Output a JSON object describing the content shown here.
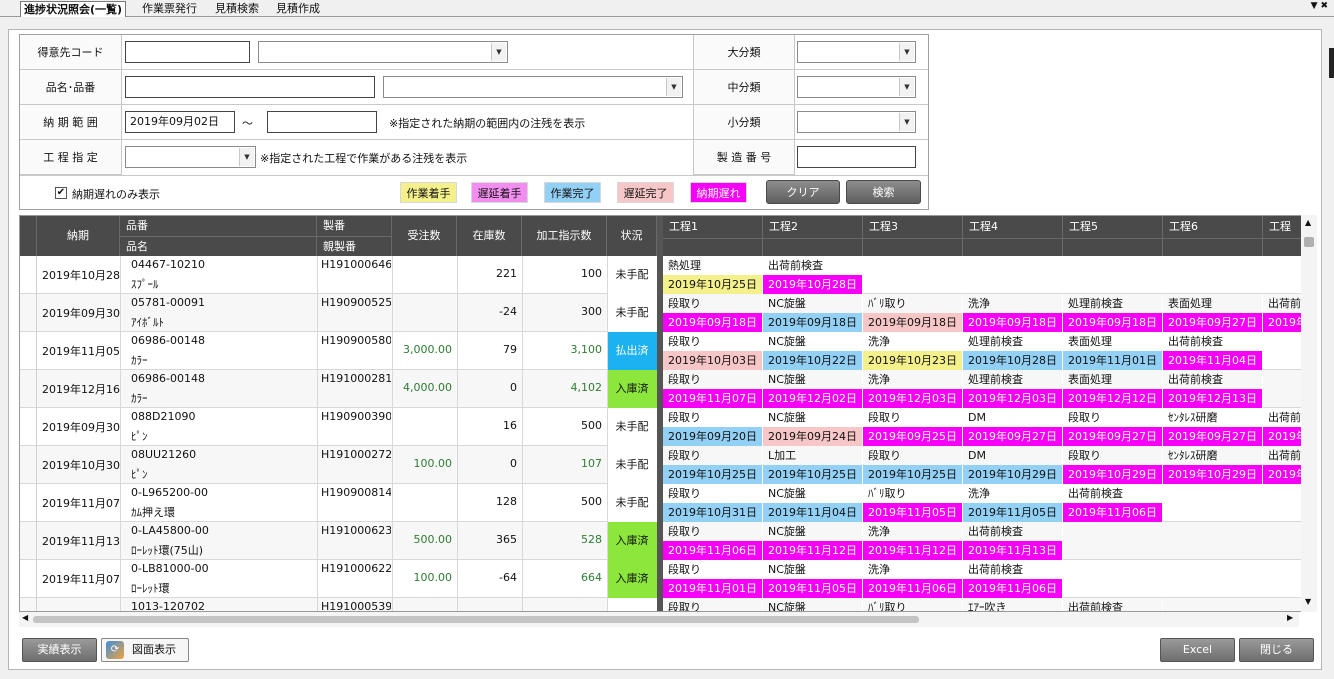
{
  "tabs": [
    "進捗状況照会(一覧)",
    "作業票発行",
    "見積検索",
    "見積作成"
  ],
  "filter": {
    "customer_label": "得意先コード",
    "item_label": "品名･品番",
    "period_label": "納 期 範 囲",
    "period_from": "2019年09月02日",
    "period_sep": "～",
    "period_note": "※指定された納期の範囲内の注残を表示",
    "process_label": "工 程 指 定",
    "process_note": "※指定された工程で作業がある注残を表示",
    "major_label": "大分類",
    "middle_label": "中分類",
    "minor_label": "小分類",
    "serial_label": "製 造 番 号",
    "late_only_label": "納期遅れのみ表示",
    "late_only_checked": "✔",
    "clear_button": "クリア",
    "search_button": "検索"
  },
  "legend": [
    {
      "label": "作業着手",
      "color": "#f4f08c"
    },
    {
      "label": "遅延着手",
      "color": "#f28ef0"
    },
    {
      "label": "作業完了",
      "color": "#92d0f5"
    },
    {
      "label": "遅延完了",
      "color": "#f7c7c7"
    },
    {
      "label": "納期遅れ",
      "color": "#f700f7"
    }
  ],
  "grid": {
    "headers": {
      "due": "納期",
      "item_no": "品番",
      "item_name": "品名",
      "serial": "製番",
      "parent_serial": "親製番",
      "ordered": "受注数",
      "stock": "在庫数",
      "instructed": "加工指示数",
      "status": "状況",
      "processes": [
        "工程1",
        "工程2",
        "工程3",
        "工程4",
        "工程5",
        "工程6",
        "工程"
      ]
    },
    "rows": [
      {
        "due": "2019年10月28日",
        "item_no": "04467-10210",
        "item_name": "ｽﾌﾟｰﾙ",
        "serial": "H191000646",
        "ordered": "",
        "stock": "221",
        "instructed": "100",
        "status": "未手配",
        "status_color": "#ffffff",
        "procs": [
          {
            "n": "熱処理",
            "d": "2019年10月25日",
            "c": "#f4f08c"
          },
          {
            "n": "出荷前検査",
            "d": "2019年10月28日",
            "c": "#f700f7"
          }
        ]
      },
      {
        "due": "2019年09月30日",
        "item_no": "05781-00091",
        "item_name": "ｱｲﾎﾞﾙﾄ",
        "serial": "H190900525",
        "ordered": "",
        "stock": "-24",
        "instructed": "300",
        "status": "未手配",
        "status_color": "#ffffff",
        "procs": [
          {
            "n": "段取り",
            "d": "2019年09月18日",
            "c": "#f700f7"
          },
          {
            "n": "NC旋盤",
            "d": "2019年09月18日",
            "c": "#92d0f5"
          },
          {
            "n": "ﾊﾞﾘ取り",
            "d": "2019年09月18日",
            "c": "#f7c7c7"
          },
          {
            "n": "洗浄",
            "d": "2019年09月18日",
            "c": "#f700f7"
          },
          {
            "n": "処理前検査",
            "d": "2019年09月18日",
            "c": "#f700f7"
          },
          {
            "n": "表面処理",
            "d": "2019年09月27日",
            "c": "#f700f7"
          },
          {
            "n": "出荷前",
            "d": "2019年",
            "c": "#f700f7"
          }
        ]
      },
      {
        "due": "2019年11月05日",
        "item_no": "06986-00148",
        "item_name": "ｶﾗｰ",
        "serial": "H190900580",
        "ordered": "3,000.00",
        "stock": "79",
        "instructed": "3,100",
        "status": "払出済",
        "status_color": "#1cb1f0",
        "procs": [
          {
            "n": "段取り",
            "d": "2019年10月03日",
            "c": "#f7c7c7"
          },
          {
            "n": "NC旋盤",
            "d": "2019年10月22日",
            "c": "#92d0f5"
          },
          {
            "n": "洗浄",
            "d": "2019年10月23日",
            "c": "#f4f08c"
          },
          {
            "n": "処理前検査",
            "d": "2019年10月28日",
            "c": "#92d0f5"
          },
          {
            "n": "表面処理",
            "d": "2019年11月01日",
            "c": "#92d0f5"
          },
          {
            "n": "出荷前検査",
            "d": "2019年11月04日",
            "c": "#f700f7"
          }
        ]
      },
      {
        "due": "2019年12月16日",
        "item_no": "06986-00148",
        "item_name": "ｶﾗｰ",
        "serial": "H191000281",
        "ordered": "4,000.00",
        "stock": "0",
        "instructed": "4,102",
        "status": "入庫済",
        "status_color": "#8ce63c",
        "procs": [
          {
            "n": "段取り",
            "d": "2019年11月07日",
            "c": "#f700f7"
          },
          {
            "n": "NC旋盤",
            "d": "2019年12月02日",
            "c": "#f700f7"
          },
          {
            "n": "洗浄",
            "d": "2019年12月03日",
            "c": "#f700f7"
          },
          {
            "n": "処理前検査",
            "d": "2019年12月03日",
            "c": "#f700f7"
          },
          {
            "n": "表面処理",
            "d": "2019年12月12日",
            "c": "#f700f7"
          },
          {
            "n": "出荷前検査",
            "d": "2019年12月13日",
            "c": "#f700f7"
          }
        ]
      },
      {
        "due": "2019年09月30日",
        "item_no": "088D21090",
        "item_name": "ﾋﾟﾝ",
        "serial": "H190900390",
        "ordered": "",
        "stock": "16",
        "instructed": "500",
        "status": "未手配",
        "status_color": "#ffffff",
        "procs": [
          {
            "n": "段取り",
            "d": "2019年09月20日",
            "c": "#92d0f5"
          },
          {
            "n": "NC旋盤",
            "d": "2019年09月24日",
            "c": "#f7c7c7"
          },
          {
            "n": "段取り",
            "d": "2019年09月25日",
            "c": "#f700f7"
          },
          {
            "n": "DM",
            "d": "2019年09月27日",
            "c": "#f700f7"
          },
          {
            "n": "段取り",
            "d": "2019年09月27日",
            "c": "#f700f7"
          },
          {
            "n": "ｾﾝﾀﾚｽ研磨",
            "d": "2019年09月27日",
            "c": "#f700f7"
          },
          {
            "n": "出荷前",
            "d": "2019年",
            "c": "#f700f7"
          }
        ]
      },
      {
        "due": "2019年10月30日",
        "item_no": "08UU21260",
        "item_name": "ﾋﾟﾝ",
        "serial": "H191000272",
        "ordered": "100.00",
        "stock": "0",
        "instructed": "107",
        "status": "未手配",
        "status_color": "#ffffff",
        "procs": [
          {
            "n": "段取り",
            "d": "2019年10月25日",
            "c": "#92d0f5"
          },
          {
            "n": "L加工",
            "d": "2019年10月25日",
            "c": "#92d0f5"
          },
          {
            "n": "段取り",
            "d": "2019年10月25日",
            "c": "#92d0f5"
          },
          {
            "n": "DM",
            "d": "2019年10月29日",
            "c": "#92d0f5"
          },
          {
            "n": "段取り",
            "d": "2019年10月29日",
            "c": "#f700f7"
          },
          {
            "n": "ｾﾝﾀﾚｽ研磨",
            "d": "2019年10月29日",
            "c": "#f700f7"
          },
          {
            "n": "出荷前",
            "d": "2019年",
            "c": "#f700f7"
          }
        ]
      },
      {
        "due": "2019年11月07日",
        "item_no": "0-L965200-00",
        "item_name": "ｶﾑ押え環",
        "serial": "H190900814",
        "ordered": "",
        "stock": "128",
        "instructed": "500",
        "status": "未手配",
        "status_color": "#ffffff",
        "procs": [
          {
            "n": "段取り",
            "d": "2019年10月31日",
            "c": "#92d0f5"
          },
          {
            "n": "NC旋盤",
            "d": "2019年11月04日",
            "c": "#92d0f5"
          },
          {
            "n": "ﾊﾞﾘ取り",
            "d": "2019年11月05日",
            "c": "#f700f7"
          },
          {
            "n": "洗浄",
            "d": "2019年11月05日",
            "c": "#92d0f5"
          },
          {
            "n": "出荷前検査",
            "d": "2019年11月06日",
            "c": "#f700f7"
          }
        ]
      },
      {
        "due": "2019年11月13日",
        "item_no": "0-LA45800-00",
        "item_name": "ﾛｰﾚｯﾄ環(75山)",
        "serial": "H191000623",
        "ordered": "500.00",
        "stock": "365",
        "instructed": "528",
        "status": "入庫済",
        "status_color": "#8ce63c",
        "procs": [
          {
            "n": "段取り",
            "d": "2019年11月06日",
            "c": "#f700f7"
          },
          {
            "n": "NC旋盤",
            "d": "2019年11月12日",
            "c": "#f700f7"
          },
          {
            "n": "洗浄",
            "d": "2019年11月12日",
            "c": "#f700f7"
          },
          {
            "n": "出荷前検査",
            "d": "2019年11月13日",
            "c": "#f700f7"
          }
        ]
      },
      {
        "due": "2019年11月07日",
        "item_no": "0-LB81000-00",
        "item_name": "ﾛｰﾚｯﾄ環",
        "serial": "H191000622",
        "ordered": "100.00",
        "stock": "-64",
        "instructed": "664",
        "status": "入庫済",
        "status_color": "#8ce63c",
        "procs": [
          {
            "n": "段取り",
            "d": "2019年11月01日",
            "c": "#f700f7"
          },
          {
            "n": "NC旋盤",
            "d": "2019年11月05日",
            "c": "#f700f7"
          },
          {
            "n": "洗浄",
            "d": "2019年11月06日",
            "c": "#f700f7"
          },
          {
            "n": "出荷前検査",
            "d": "2019年11月06日",
            "c": "#f700f7"
          }
        ]
      },
      {
        "due": "",
        "item_no": "1013-120702",
        "item_name": "",
        "serial": "H191000539",
        "ordered": "",
        "stock": "",
        "instructed": "",
        "status": "",
        "status_color": "#ffffff",
        "procs": [
          {
            "n": "段取り",
            "d": "",
            "c": "#ffffff"
          },
          {
            "n": "NC旋盤",
            "d": "",
            "c": "#ffffff"
          },
          {
            "n": "ﾊﾞﾘ取り",
            "d": "",
            "c": "#ffffff"
          },
          {
            "n": "ｴｱｰ吹き",
            "d": "",
            "c": "#ffffff"
          },
          {
            "n": "出荷前検査",
            "d": "",
            "c": "#ffffff"
          }
        ]
      }
    ]
  },
  "footer": {
    "results_button": "実績表示",
    "drawing_button": "図面表示",
    "excel_button": "Excel",
    "close_button": "閉じる"
  }
}
